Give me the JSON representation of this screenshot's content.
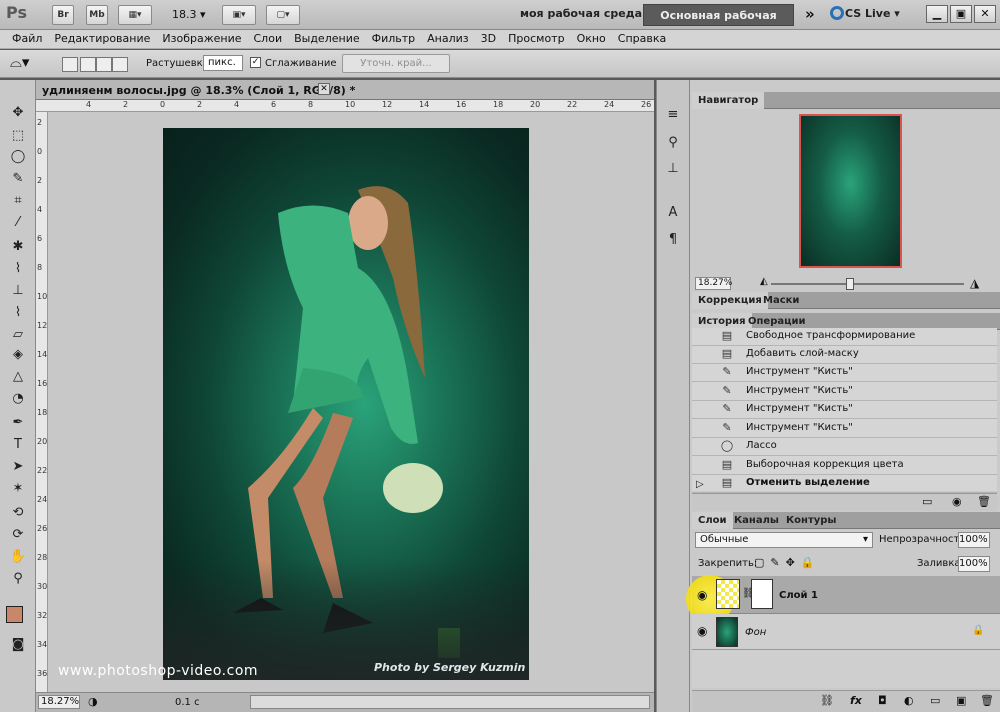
{
  "app": {
    "logo": "Ps",
    "bridge_label": "Br",
    "minibridge_label": "Mb",
    "zoom_value": "18.3",
    "workspace_custom": "моя рабочая среда",
    "workspace_main": "Основная рабочая среда",
    "more": "»",
    "cslive": "CS Live"
  },
  "menu": [
    "Файл",
    "Редактирование",
    "Изображение",
    "Слои",
    "Выделение",
    "Фильтр",
    "Анализ",
    "3D",
    "Просмотр",
    "Окно",
    "Справка"
  ],
  "options": {
    "feather_label": "Растушевка:",
    "feather_value": "пикс.",
    "antialias_label": "Сглаживание",
    "antialias_checked": true,
    "refine_edge": "Уточн. край..."
  },
  "document": {
    "tab_title": "удлиняенм волосы.jpg @ 18.3% (Слой 1, RGB/8) *",
    "ruler_h": [
      "4",
      "2",
      "0",
      "2",
      "4",
      "6",
      "8",
      "10",
      "12",
      "14",
      "16",
      "18",
      "20",
      "22",
      "24",
      "26"
    ],
    "ruler_v": [
      "2",
      "0",
      "2",
      "4",
      "6",
      "8",
      "10",
      "12",
      "14",
      "16",
      "18",
      "20",
      "22",
      "24",
      "26",
      "28",
      "30",
      "32",
      "34",
      "36"
    ],
    "photo_credit": "Photo by Sergey Kuzmin",
    "watermark": "www.photoshop-video.com",
    "status_zoom": "18.27%",
    "status_info": "0.1 с"
  },
  "navigator": {
    "tab": "Навигатор",
    "zoom": "18.27%"
  },
  "panels": {
    "correction_tab": "Коррекция",
    "masks_tab": "Маски",
    "history_tab": "История",
    "actions_tab": "Операции",
    "layers_tab": "Слои",
    "channels_tab": "Каналы",
    "paths_tab": "Контуры"
  },
  "history": [
    {
      "icon": "document-icon",
      "text": "Свободное трансформирование"
    },
    {
      "icon": "document-icon",
      "text": "Добавить слой-маску"
    },
    {
      "icon": "brush-icon",
      "text": "Инструмент \"Кисть\""
    },
    {
      "icon": "brush-icon",
      "text": "Инструмент \"Кисть\""
    },
    {
      "icon": "brush-icon",
      "text": "Инструмент \"Кисть\""
    },
    {
      "icon": "brush-icon",
      "text": "Инструмент \"Кисть\""
    },
    {
      "icon": "lasso-icon",
      "text": "Лассо"
    },
    {
      "icon": "document-icon",
      "text": "Выборочная коррекция цвета"
    },
    {
      "icon": "document-icon",
      "text": "Отменить выделение"
    }
  ],
  "layers": {
    "blend_mode": "Обычные",
    "opacity_label": "Непрозрачность:",
    "opacity": "100%",
    "lock_label": "Закрепить:",
    "fill_label": "Заливка:",
    "fill": "100%",
    "items": [
      {
        "name": "Слой 1"
      },
      {
        "name": "Фон"
      }
    ]
  },
  "colors": {
    "foreground": "#c9876a",
    "highlight": "#f5e000"
  }
}
